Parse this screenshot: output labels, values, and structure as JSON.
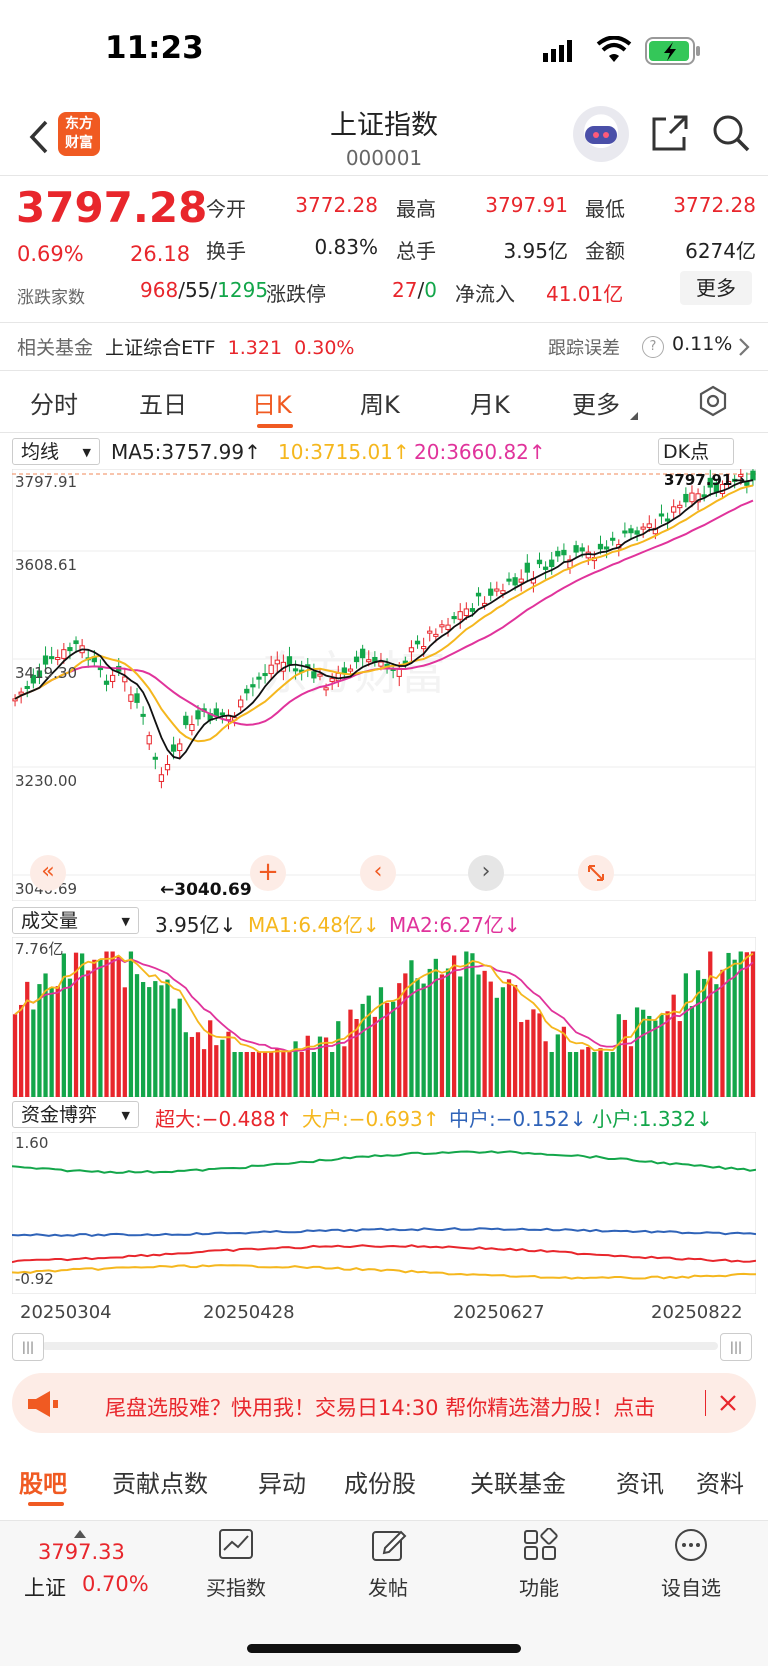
{
  "status_bar": {
    "time": "11:23"
  },
  "header": {
    "title": "上证指数",
    "code": "000001",
    "logo_text": "东方财富"
  },
  "quote": {
    "price": "3797.28",
    "change_pct": "0.69%",
    "change": "26.18",
    "open_label": "今开",
    "open": "3772.28",
    "high_label": "最高",
    "high": "3797.91",
    "low_label": "最低",
    "low": "3772.28",
    "turnover_label": "换手",
    "turnover": "0.83%",
    "volume_label": "总手",
    "volume": "3.95亿",
    "amount_label": "金额",
    "amount": "6274亿",
    "breadth_label": "涨跌家数",
    "up": "968",
    "sep1": "/",
    "flat": "55",
    "sep2": "/",
    "down": "1295",
    "limit_label": "涨跌停",
    "limit_up": "27",
    "sep3": "/",
    "limit_down": "0",
    "inflow_label": "净流入",
    "inflow": "41.01亿",
    "more_label": "更多"
  },
  "fund": {
    "label": "相关基金",
    "name": "上证综合ETF",
    "price": "1.321",
    "pct": "0.30%",
    "err_label": "跟踪误差",
    "err_value": "0.11%"
  },
  "tabs": [
    "分时",
    "五日",
    "日K",
    "周K",
    "月K",
    "更多"
  ],
  "kline": {
    "ma_select": "均线",
    "ma5": "MA5:3757.99↑",
    "ma10": "10:3715.01↑",
    "ma20": "20:3660.82↑",
    "dk_label": "DK点",
    "y_labels": [
      "3797.91",
      "3608.61",
      "3419.30",
      "3230.00",
      "3040.69"
    ],
    "high_marker": "3797.91→",
    "low_marker": "←3040.69",
    "ylim": [
      3040.69,
      3797.91
    ]
  },
  "volume": {
    "select": "成交量",
    "value": "3.95亿↓",
    "ma1": "MA1:6.48亿↓",
    "ma2": "MA2:6.27亿↓",
    "max_label": "7.76亿"
  },
  "capital": {
    "select": "资金博弈",
    "super": "超大:−0.488↑",
    "large": "大户:−0.693↑",
    "mid": "中户:−0.152↓",
    "small": "小户:1.332↓",
    "top": "1.60",
    "bottom": "-0.92"
  },
  "dates": [
    "20250304",
    "20250428",
    "20250627",
    "20250822"
  ],
  "banner": {
    "text": "尾盘选股难？快用我！交易日14:30 帮你精选潜力股！点击"
  },
  "bottom_tabs": [
    "股吧",
    "贡献点数",
    "异动",
    "成份股",
    "关联基金",
    "资讯",
    "资料"
  ],
  "footer": {
    "index_price": "3797.33",
    "index_name": "上证",
    "index_pct": "0.70%",
    "buttons": [
      "买指数",
      "发帖",
      "功能",
      "设自选"
    ]
  },
  "colors": {
    "up": "#e8262c",
    "down": "#13a64a",
    "ma5": "#000000",
    "ma10": "#f5b71e",
    "ma20": "#e0339b",
    "brand": "#f05a22"
  }
}
